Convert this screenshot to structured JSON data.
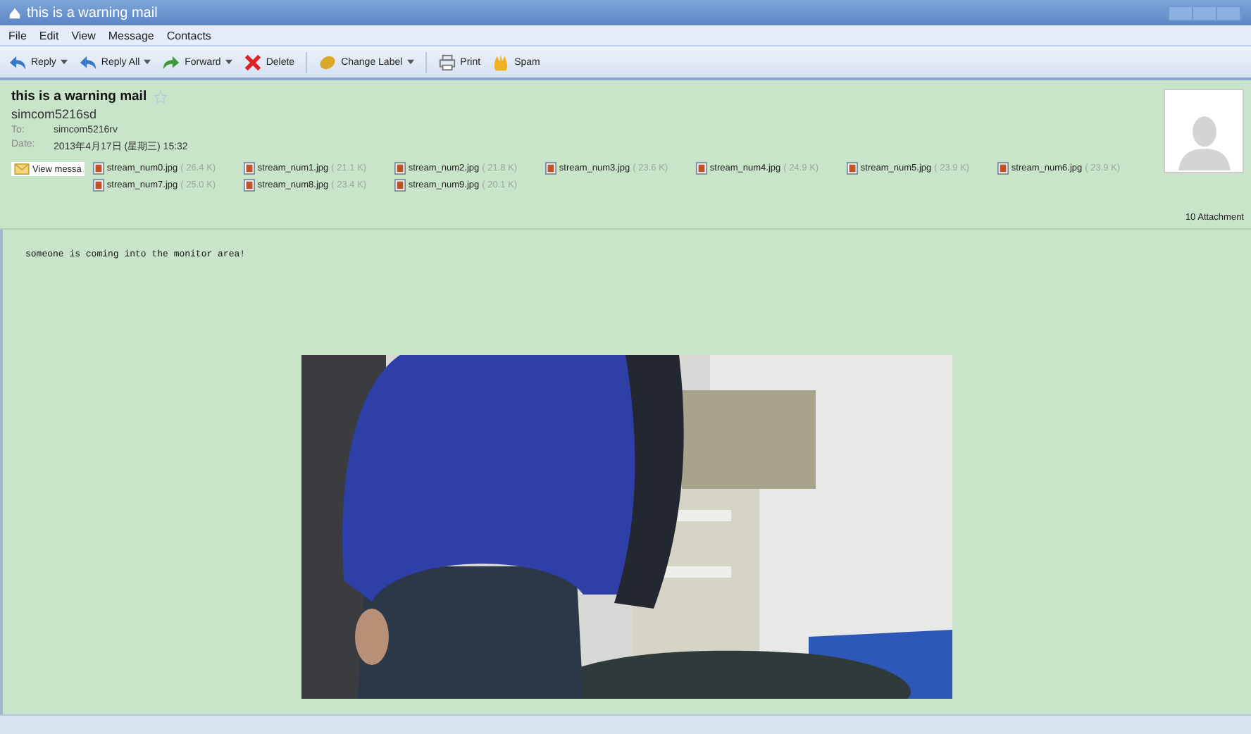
{
  "window": {
    "title": "this is a warning mail"
  },
  "menu": [
    "File",
    "Edit",
    "View",
    "Message",
    "Contacts"
  ],
  "toolbar": [
    {
      "kind": "reply",
      "label": "Reply",
      "dropdown": true
    },
    {
      "kind": "reply-all",
      "label": "Reply All",
      "dropdown": true
    },
    {
      "kind": "forward",
      "label": "Forward",
      "dropdown": true
    },
    {
      "kind": "delete",
      "label": "Delete",
      "dropdown": false
    },
    {
      "kind": "label",
      "label": "Change Label",
      "dropdown": true
    },
    {
      "kind": "print",
      "label": "Print",
      "dropdown": false
    },
    {
      "kind": "spam",
      "label": "Spam",
      "dropdown": false
    }
  ],
  "message": {
    "subject": "this is a warning mail",
    "starred": false,
    "from": "simcom5216sd",
    "to_label": "To:",
    "to": "simcom5216rv",
    "date_label": "Date:",
    "date": "2013年4月17日 (星期三) 15:32",
    "view_button": "View messa",
    "attachments": [
      {
        "name": "stream_num0.jpg",
        "size": "( 26.4 K)"
      },
      {
        "name": "stream_num1.jpg",
        "size": "( 21.1 K)"
      },
      {
        "name": "stream_num2.jpg",
        "size": "( 21.8 K)"
      },
      {
        "name": "stream_num3.jpg",
        "size": "( 23.6 K)"
      },
      {
        "name": "stream_num4.jpg",
        "size": "( 24.9 K)"
      },
      {
        "name": "stream_num5.jpg",
        "size": "( 23.9 K)"
      },
      {
        "name": "stream_num6.jpg",
        "size": "( 23.9 K)"
      },
      {
        "name": "stream_num7.jpg",
        "size": "( 25.0 K)"
      },
      {
        "name": "stream_num8.jpg",
        "size": "( 23.4 K)"
      },
      {
        "name": "stream_num9.jpg",
        "size": "( 20.1 K)"
      }
    ],
    "attachment_count": "10 Attachment",
    "body": "someone is coming into the monitor area!"
  }
}
